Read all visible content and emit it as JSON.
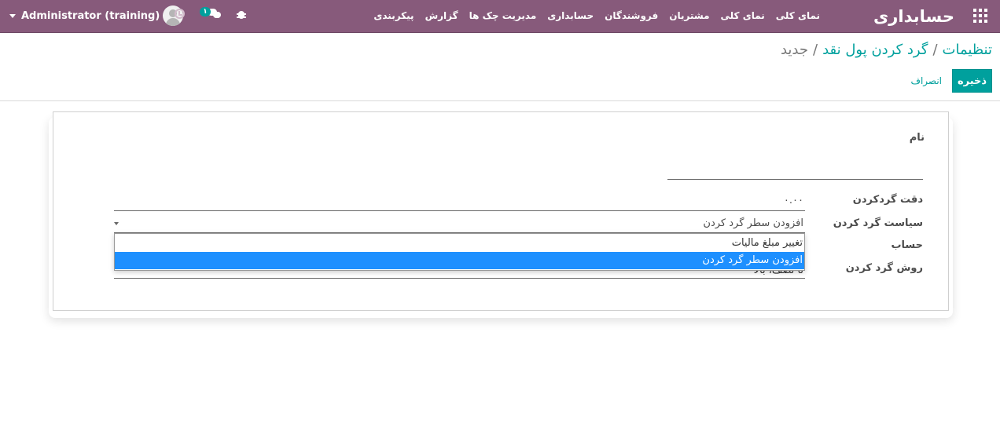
{
  "navbar": {
    "app_title": "حسابداری",
    "menu": [
      "نمای کلی",
      "نمای کلی",
      "مشتریان",
      "فروشندگان",
      "حسابداری",
      "مدیریت چک ها",
      "گزارش",
      "پیکربندی"
    ],
    "user_name": "Administrator (training)",
    "chat_badge": "۱",
    "icons": [
      "apps-grid-icon",
      "user-avatar",
      "clock-icon",
      "chat-icon",
      "bug-icon",
      "caret-down-icon"
    ]
  },
  "breadcrumb": {
    "item1": "تنظیمات",
    "item2": "گرد کردن پول نقد",
    "current": "جدید",
    "separator": "/"
  },
  "actions": {
    "save": "ذخیره",
    "discard": "انصراف"
  },
  "form": {
    "name_label": "نام",
    "precision_label": "دقت گردکردن",
    "precision_value": "۰.۰۰",
    "policy_label": "سیاست گرد کردن",
    "policy_value": "افزودن سطر گرد کردن",
    "account_label": "حساب",
    "method_label": "روش گرد کردن",
    "method_value_partial": "تا نصف، بالا"
  },
  "dropdown": {
    "options": [
      "تغییر مبلغ مالیات",
      "افزودن سطر گرد کردن"
    ],
    "selected": "افزودن سطر گرد کردن"
  },
  "colors": {
    "navbar": "#875a7b",
    "accent": "#00a09d",
    "selected_option": "#1e90ff"
  }
}
